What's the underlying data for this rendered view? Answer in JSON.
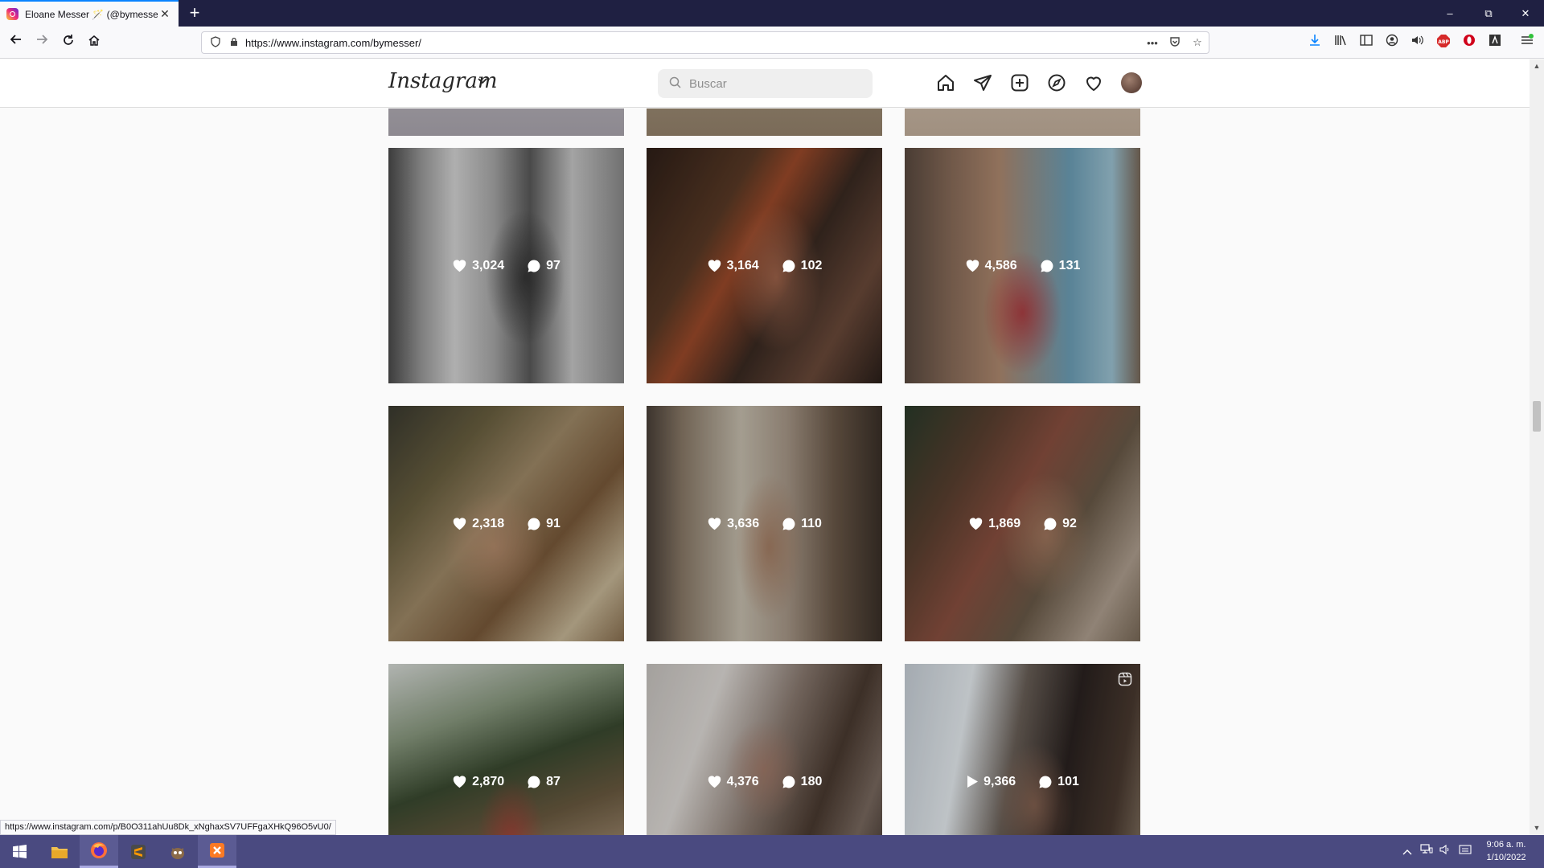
{
  "browser": {
    "tab_title": "Eloane Messer 🪄 (@bymesser)",
    "tab_close": "✕",
    "new_tab": "+",
    "url": "https://www.instagram.com/bymesser/",
    "status_url": "https://www.instagram.com/p/B0O311ahUu8Dk_xNghaxSV7UFFgaXHkQ96O5vU0/",
    "window_controls": [
      "–",
      "⧉",
      "✕"
    ],
    "nav_icons": [
      "back-icon",
      "forward-icon",
      "reload-icon",
      "home-icon"
    ],
    "toolbar_icons": [
      "download-icon",
      "library-icon",
      "sidebar-icon",
      "account-icon",
      "speaker-icon",
      "adblock-icon",
      "opera-icon",
      "extension-icon",
      "menu-icon"
    ]
  },
  "instagram": {
    "logo": "Instagram",
    "search_placeholder": "Buscar",
    "nav_icons": [
      "home-icon",
      "direct-icon",
      "new-post-icon",
      "explore-icon",
      "activity-heart-icon",
      "profile-avatar"
    ]
  },
  "posts": [
    {
      "likes": "3,024",
      "comments": "97",
      "type": "photo"
    },
    {
      "likes": "3,164",
      "comments": "102",
      "type": "photo"
    },
    {
      "likes": "4,586",
      "comments": "131",
      "type": "photo"
    },
    {
      "likes": "2,318",
      "comments": "91",
      "type": "photo"
    },
    {
      "likes": "3,636",
      "comments": "110",
      "type": "photo"
    },
    {
      "likes": "1,869",
      "comments": "92",
      "type": "photo"
    },
    {
      "likes": "2,870",
      "comments": "87",
      "type": "photo"
    },
    {
      "likes": "4,376",
      "comments": "180",
      "type": "photo"
    },
    {
      "likes": "9,366",
      "comments": "101",
      "type": "reel"
    }
  ],
  "taskbar": {
    "apps": [
      "windows-start-icon",
      "file-explorer-icon",
      "firefox-icon",
      "sublime-text-icon",
      "gimp-icon",
      "xampp-icon"
    ],
    "time": "9:06 a. m.",
    "date": "1/10/2022"
  },
  "colors": {
    "tabbar": "#1f2042",
    "taskbar": "#4a4a80",
    "instagram_bg": "#fafafa"
  }
}
